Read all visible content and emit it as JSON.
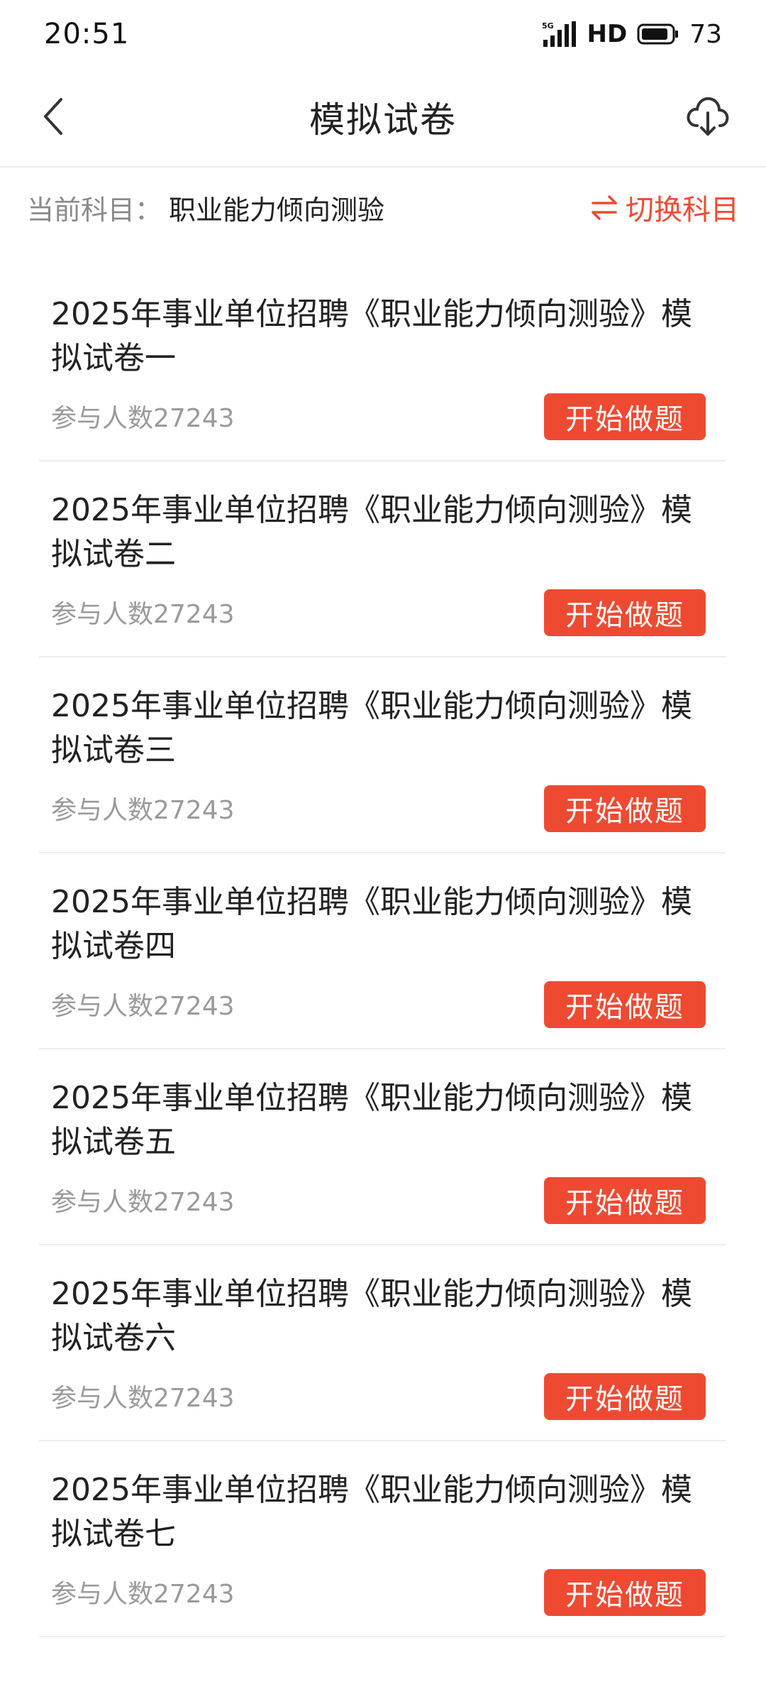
{
  "status_bar": {
    "time": "20:51",
    "network": "HD",
    "battery": "73",
    "icons": [
      "5g-signal-icon",
      "battery-icon"
    ]
  },
  "header": {
    "title": "模拟试卷",
    "back_icon": "chevron-left-icon",
    "download_icon": "cloud-download-icon"
  },
  "subject": {
    "label": "当前科目：",
    "value": "职业能力倾向测验",
    "switch_label": "切换科目",
    "switch_icon": "swap-arrows-icon"
  },
  "colors": {
    "accent": "#ee4a32",
    "text_primary": "#222222",
    "text_secondary": "#9a9a9a"
  },
  "exams": [
    {
      "title": "2025年事业单位招聘《职业能力倾向测验》模拟试卷一",
      "participants": "参与人数27243",
      "button": "开始做题"
    },
    {
      "title": "2025年事业单位招聘《职业能力倾向测验》模拟试卷二",
      "participants": "参与人数27243",
      "button": "开始做题"
    },
    {
      "title": "2025年事业单位招聘《职业能力倾向测验》模拟试卷三",
      "participants": "参与人数27243",
      "button": "开始做题"
    },
    {
      "title": "2025年事业单位招聘《职业能力倾向测验》模拟试卷四",
      "participants": "参与人数27243",
      "button": "开始做题"
    },
    {
      "title": "2025年事业单位招聘《职业能力倾向测验》模拟试卷五",
      "participants": "参与人数27243",
      "button": "开始做题"
    },
    {
      "title": "2025年事业单位招聘《职业能力倾向测验》模拟试卷六",
      "participants": "参与人数27243",
      "button": "开始做题"
    },
    {
      "title": "2025年事业单位招聘《职业能力倾向测验》模拟试卷七",
      "participants": "参与人数27243",
      "button": "开始做题"
    }
  ]
}
